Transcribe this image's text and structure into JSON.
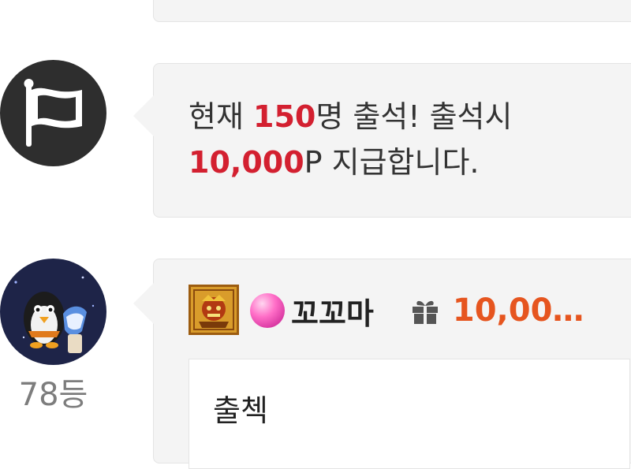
{
  "notice": {
    "prefix": "현재 ",
    "count": "150",
    "middle": "명 출석! 출석시",
    "points": "10,000",
    "suffix": "P 지급합니다."
  },
  "attendance": {
    "rank": "78등",
    "nickname": "꼬꼬마",
    "reward": "10,00…",
    "comment": "출첵"
  },
  "colors": {
    "highlight_red": "#d32030",
    "points_orange": "#e6551f",
    "bubble_bg": "#f4f4f4",
    "flag_avatar_bg": "#2e2e2e"
  },
  "icons": [
    "flag-icon",
    "user-avatar",
    "level-badge-icon",
    "gem-icon",
    "gift-icon"
  ]
}
